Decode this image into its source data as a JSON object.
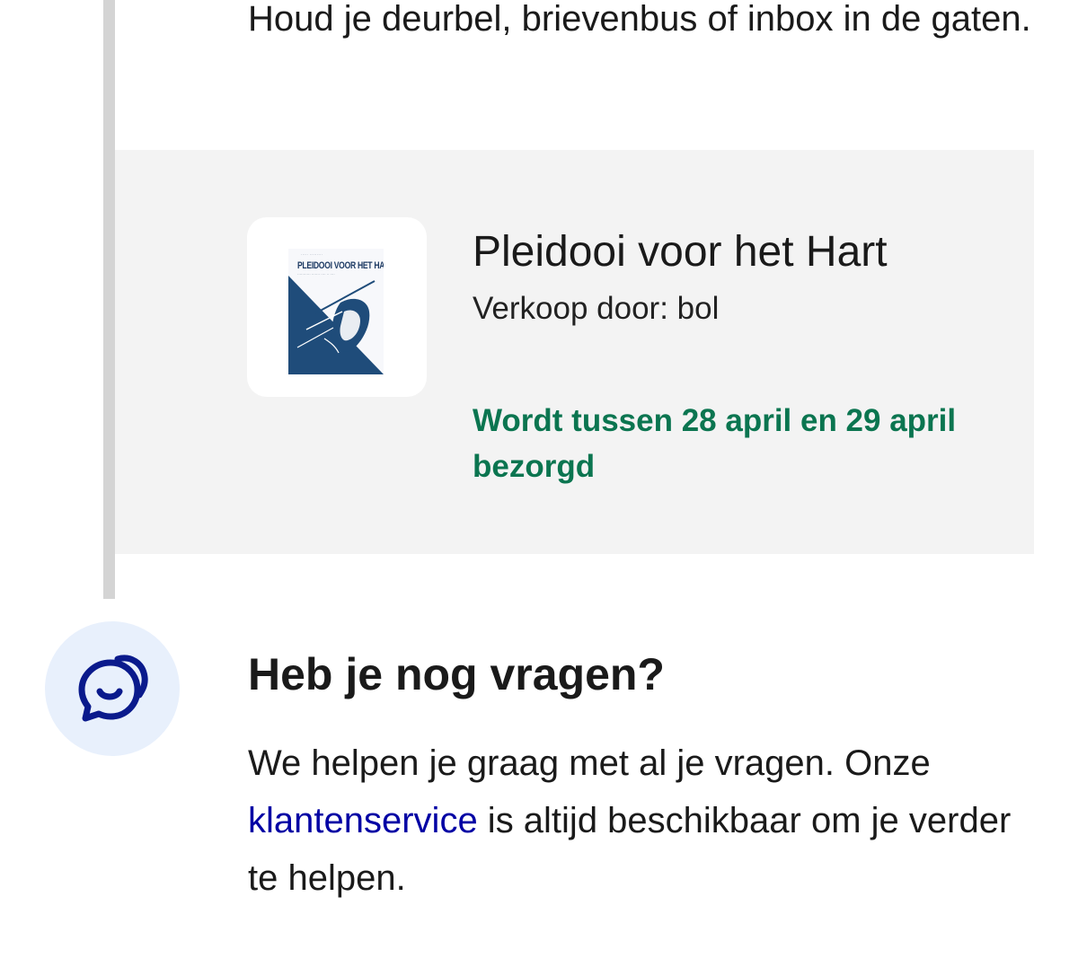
{
  "intro": {
    "text": "Houd je deurbel, brievenbus of inbox in de gaten."
  },
  "product": {
    "title": "Pleidooi voor het Hart",
    "seller": "Verkoop door: bol",
    "delivery": "Wordt tussen 28 april en 29 april bezorgd",
    "cover": {
      "title": "PLEIDOOI VOOR HET HART"
    }
  },
  "help": {
    "icon": "chat-bubbles-icon",
    "heading": "Heb je nog vragen?",
    "text_before": "We helpen je graag met al je vragen. Onze ",
    "link_label": "klantenservice",
    "text_after": " is altijd beschikbaar om je verder te helpen."
  },
  "colors": {
    "timeline": "#d4d4d4",
    "card_background": "#f3f3f3",
    "delivery_green": "#0b7550",
    "link_blue": "#0000a4",
    "icon_background": "#e8f0fc",
    "icon_stroke": "#0a1a8c"
  }
}
